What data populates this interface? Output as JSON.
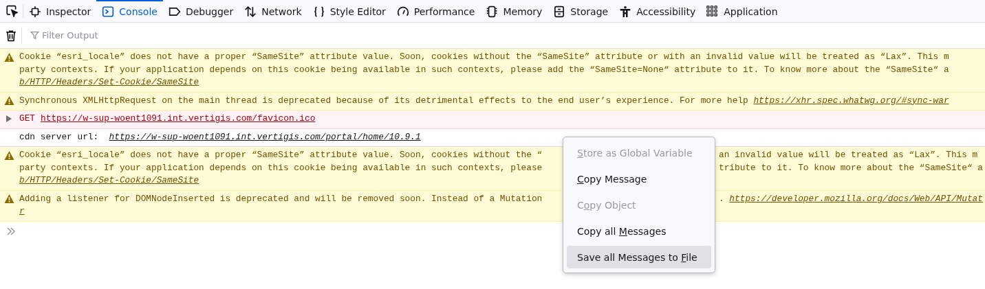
{
  "toolbar": {
    "tabs": [
      {
        "label": "Inspector",
        "selected": false
      },
      {
        "label": "Console",
        "selected": true
      },
      {
        "label": "Debugger",
        "selected": false
      },
      {
        "label": "Network",
        "selected": false
      },
      {
        "label": "Style Editor",
        "selected": false
      },
      {
        "label": "Performance",
        "selected": false
      },
      {
        "label": "Memory",
        "selected": false
      },
      {
        "label": "Storage",
        "selected": false
      },
      {
        "label": "Accessibility",
        "selected": false
      },
      {
        "label": "Application",
        "selected": false
      }
    ]
  },
  "filter": {
    "placeholder": "Filter Output"
  },
  "messages": [
    {
      "kind": "warning",
      "lines": [
        {
          "segments": [
            {
              "kind": "text",
              "text": "Cookie “esri_locale” does not have a proper “SameSite” attribute value. Soon, cookies without the “SameSite” attribute or with an invalid value will be treated as “Lax”. This m"
            }
          ]
        },
        {
          "segments": [
            {
              "kind": "text",
              "text": "party contexts. If your application depends on this cookie being available in such contexts, please add the “SameSite=None“ attribute to it. To know more about the “SameSite“ a"
            }
          ]
        },
        {
          "segments": [
            {
              "kind": "link",
              "text": "b/HTTP/Headers/Set-Cookie/SameSite"
            }
          ]
        }
      ]
    },
    {
      "kind": "warning",
      "lines": [
        {
          "segments": [
            {
              "kind": "text",
              "text": "Synchronous XMLHttpRequest on the main thread is deprecated because of its detrimental effects to the end user’s experience. For more help "
            },
            {
              "kind": "link",
              "text": "https://xhr.spec.whatwg.org/#sync-war"
            }
          ]
        }
      ]
    },
    {
      "kind": "network",
      "lines": [
        {
          "segments": [
            {
              "kind": "method",
              "text": "GET"
            },
            {
              "kind": "link",
              "text": "https://w-sup-woent1091.int.vertigis.com/favicon.ico"
            }
          ]
        }
      ]
    },
    {
      "kind": "log",
      "lines": [
        {
          "segments": [
            {
              "kind": "text",
              "text": "cdn server url:  "
            },
            {
              "kind": "link",
              "text": "https://w-sup-woent1091.int.vertigis.com/portal/home/10.9.1"
            }
          ]
        }
      ]
    },
    {
      "kind": "warning",
      "lines": [
        {
          "segments": [
            {
              "kind": "text",
              "text": "Cookie “esri_locale” does not have a proper “SameSite” attribute value. Soon, cookies without the “"
            }
          ],
          "after_menu": [
            {
              "kind": "text",
              "text": "an invalid value will be treated as “Lax”. This m"
            }
          ]
        },
        {
          "segments": [
            {
              "kind": "text",
              "text": "party contexts. If your application depends on this cookie being available in such contexts, please"
            }
          ],
          "after_menu": [
            {
              "kind": "text",
              "text": "tribute to it. To know more about the “SameSite“ a"
            }
          ]
        },
        {
          "segments": [
            {
              "kind": "link",
              "text": "b/HTTP/Headers/Set-Cookie/SameSite"
            }
          ]
        }
      ]
    },
    {
      "kind": "warning",
      "lines": [
        {
          "segments": [
            {
              "kind": "text",
              "text": "Adding a listener for DOMNodeInserted is deprecated and will be removed soon. Instead of a Mutation"
            }
          ],
          "after_menu": [
            {
              "kind": "text",
              "text": ". "
            },
            {
              "kind": "link",
              "text": "https://developer.mozilla.org/docs/Web/API/Mutat"
            }
          ]
        },
        {
          "segments": [
            {
              "kind": "link",
              "text": "r"
            }
          ]
        }
      ]
    }
  ],
  "context_menu": {
    "items": [
      {
        "access_key": "S",
        "label_after": "tore as Global Variable",
        "disabled": true,
        "selected": false
      },
      {
        "access_key": "C",
        "label_after": "opy Message",
        "disabled": false,
        "selected": false
      },
      {
        "label_before": "C",
        "access_key": "o",
        "label_after": "py Object",
        "disabled": true,
        "selected": false
      },
      {
        "label_before": "Copy all ",
        "access_key": "M",
        "label_after": "essages",
        "disabled": false,
        "selected": false
      },
      {
        "label_before": "Save all Messages to ",
        "access_key": "F",
        "label_after": "ile",
        "disabled": false,
        "selected": true
      }
    ]
  }
}
